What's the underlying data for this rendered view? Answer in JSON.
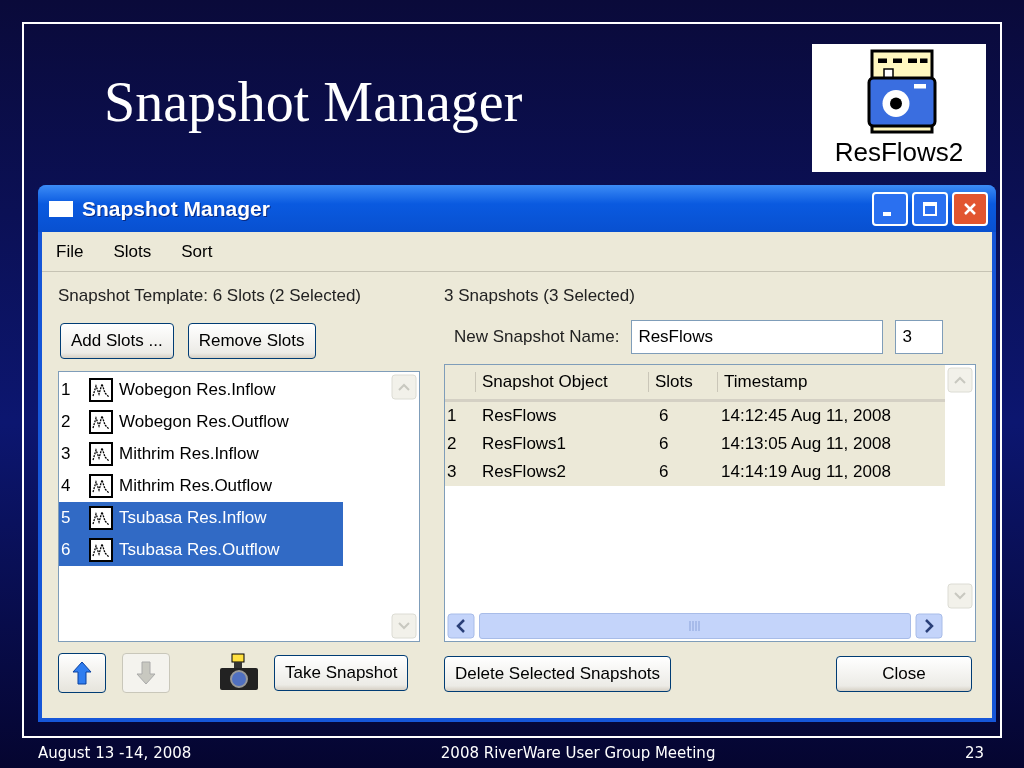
{
  "slide": {
    "title": "Snapshot Manager",
    "logo_label": "ResFlows2",
    "footer": {
      "date": "August 13 -14, 2008",
      "event": "2008 RiverWare User Group Meeting",
      "page": "23"
    }
  },
  "window": {
    "title": "Snapshot Manager"
  },
  "menu": [
    "File",
    "Slots",
    "Sort"
  ],
  "template": {
    "label": "Snapshot Template: 6 Slots (2 Selected)",
    "add_button": "Add Slots ...",
    "remove_button": "Remove Slots",
    "slots": [
      {
        "number": "1",
        "name": "Wobegon Res.Inflow",
        "selected": false
      },
      {
        "number": "2",
        "name": "Wobegon Res.Outflow",
        "selected": false
      },
      {
        "number": "3",
        "name": "Mithrim Res.Inflow",
        "selected": false
      },
      {
        "number": "4",
        "name": "Mithrim Res.Outflow",
        "selected": false
      },
      {
        "number": "5",
        "name": "Tsubasa Res.Inflow",
        "selected": true
      },
      {
        "number": "6",
        "name": "Tsubasa Res.Outflow",
        "selected": true
      }
    ],
    "move_up": {
      "disabled": false
    },
    "move_down": {
      "disabled": true
    },
    "take_button": "Take Snapshot"
  },
  "snapshots": {
    "label": "3 Snapshots (3 Selected)",
    "name_label": "New Snapshot Name:",
    "name_value": "ResFlows",
    "count_value": "3",
    "columns": [
      "Snapshot Object",
      "Slots",
      "Timestamp"
    ],
    "rows": [
      {
        "number": "1",
        "object": "ResFlows",
        "slots": "6",
        "timestamp": "14:12:45 Aug 11, 2008",
        "selected": true
      },
      {
        "number": "2",
        "object": "ResFlows1",
        "slots": "6",
        "timestamp": "14:13:05 Aug 11, 2008",
        "selected": true
      },
      {
        "number": "3",
        "object": "ResFlows2",
        "slots": "6",
        "timestamp": "14:14:19 Aug 11, 2008",
        "selected": true
      }
    ],
    "delete_button": "Delete Selected Snapshots",
    "close_button": "Close"
  }
}
